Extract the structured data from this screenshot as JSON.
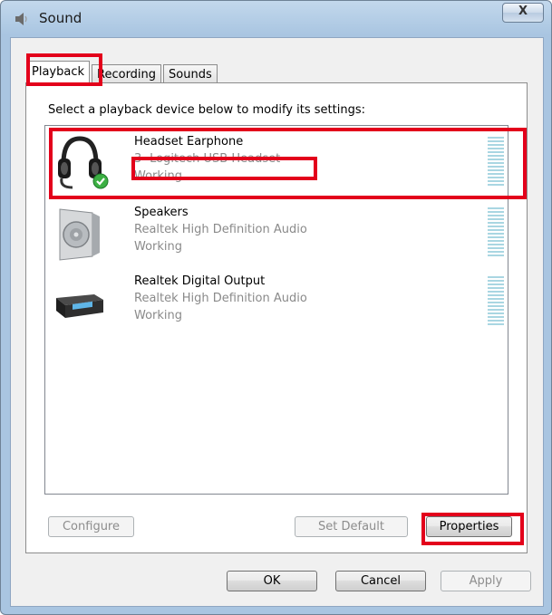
{
  "window": {
    "title": "Sound",
    "close_glyph": "X"
  },
  "tabs": [
    {
      "label": "Playback",
      "active": true
    },
    {
      "label": "Recording",
      "active": false
    },
    {
      "label": "Sounds",
      "active": false
    }
  ],
  "instruction": "Select a playback device below to modify its settings:",
  "devices": [
    {
      "name": "Headset Earphone",
      "description": "3- Logitech USB Headset",
      "status": "Working",
      "icon": "headset-icon",
      "default": true
    },
    {
      "name": "Speakers",
      "description": "Realtek High Definition Audio",
      "status": "Working",
      "icon": "speaker-icon",
      "default": false
    },
    {
      "name": "Realtek Digital Output",
      "description": "Realtek High Definition Audio",
      "status": "Working",
      "icon": "digital-output-icon",
      "default": false
    }
  ],
  "buttons": {
    "configure": "Configure",
    "set_default": "Set Default",
    "properties": "Properties",
    "ok": "OK",
    "cancel": "Cancel",
    "apply": "Apply"
  },
  "colors": {
    "highlight": "#e3001b",
    "disabled_text": "#8d8d8d",
    "meter": "#a9d6e2"
  }
}
